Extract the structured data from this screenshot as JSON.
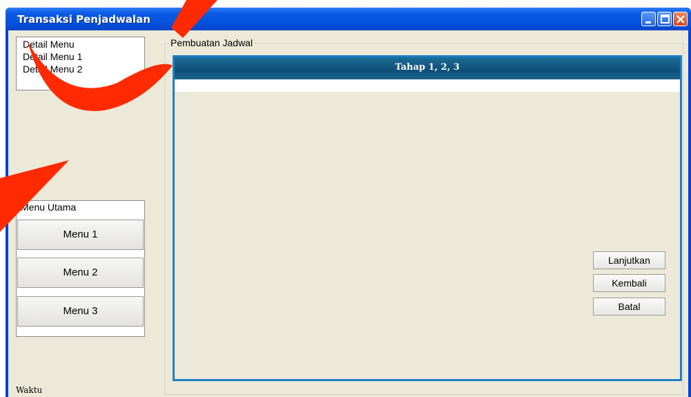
{
  "window": {
    "title": "Transaksi Penjadwalan"
  },
  "detail_menu": {
    "items": [
      "Detail Menu",
      "Detail Menu 1",
      "Detail Menu 2"
    ]
  },
  "main_menu": {
    "header": "Menu Utama",
    "buttons": [
      "Menu 1",
      "Menu 2",
      "Menu 3"
    ]
  },
  "status": {
    "time_label": "Waktu"
  },
  "group": {
    "legend": "Pembuatan Jadwal"
  },
  "wizard": {
    "header": "Tahap 1, 2, 3"
  },
  "actions": {
    "next": "Lanjutkan",
    "back": "Kembali",
    "cancel": "Batal"
  },
  "colors": {
    "titlebar": "#0b5be5",
    "client": "#ece9d8",
    "wizard_header": "#0f4f78",
    "wizard_border": "#1c7fc4",
    "watermark": "#ff2a00"
  },
  "icons": [
    "minimize-icon",
    "maximize-icon",
    "close-icon"
  ]
}
